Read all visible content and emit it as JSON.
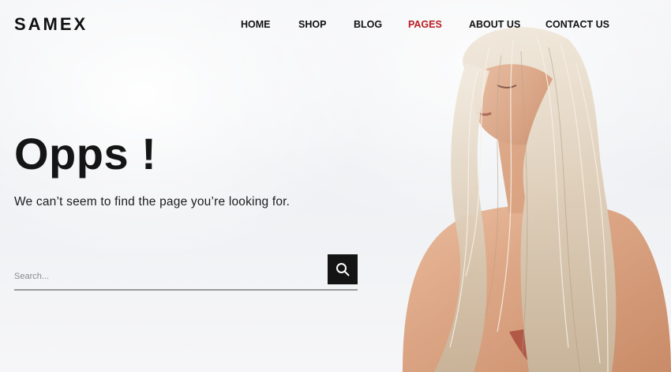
{
  "brand": {
    "logo_text": "SAMEX"
  },
  "nav": {
    "items": [
      {
        "label": "HOME",
        "active": false
      },
      {
        "label": "SHOP",
        "active": false
      },
      {
        "label": "BLOG",
        "active": false
      },
      {
        "label": "PAGES",
        "active": true
      },
      {
        "label": "ABOUT US",
        "active": false
      },
      {
        "label": "CONTACT US",
        "active": false
      }
    ],
    "active_color": "#b81d24"
  },
  "hero": {
    "title": "Opps !",
    "subtitle": "We can’t seem to find the page you’re looking for."
  },
  "search": {
    "placeholder": "Search...",
    "value": "",
    "button_icon": "search-icon"
  },
  "colors": {
    "text": "#151515",
    "button_bg": "#141414",
    "accent": "#b81d24"
  }
}
